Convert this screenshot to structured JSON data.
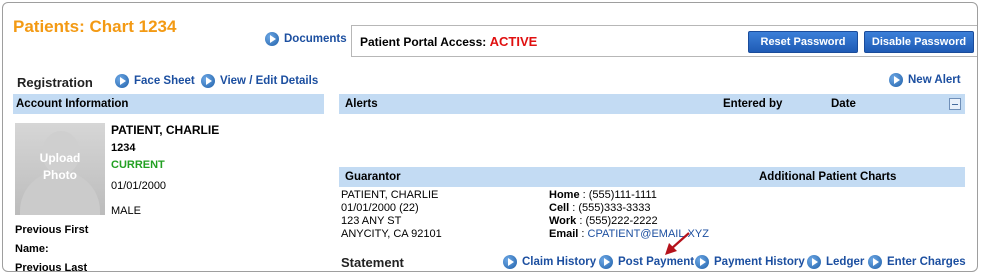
{
  "header": {
    "title": "Patients: Chart 1234",
    "documents_label": "Documents",
    "portal_label": "Patient Portal Access:",
    "portal_status": "ACTIVE",
    "reset_password_label": "Reset Password",
    "disable_password_label": "Disable Password"
  },
  "registration": {
    "title": "Registration",
    "face_sheet_label": "Face Sheet",
    "view_edit_label": "View / Edit Details"
  },
  "account": {
    "bar_title": "Account Information",
    "photo_line1": "Upload",
    "photo_line2": "Photo",
    "name": "PATIENT, CHARLIE",
    "chart_number": "1234",
    "status": "CURRENT",
    "dob": "01/01/2000",
    "sex": "MALE",
    "prev_first_label": "Previous First",
    "prev_first_label2": "Name:",
    "prev_last_label": "Previous Last"
  },
  "alerts": {
    "new_alert_label": "New Alert",
    "col_alerts": "Alerts",
    "col_entered_by": "Entered by",
    "col_date": "Date"
  },
  "guarantor": {
    "bar_title": "Guarantor",
    "additional_charts": "Additional Patient Charts",
    "name": "PATIENT, CHARLIE",
    "dob_age": "01/01/2000 (22)",
    "address1": "123 ANY ST",
    "address2": "ANYCITY, CA 92101",
    "home_label": "Home",
    "home_value": ": (555)111-1111",
    "cell_label": "Cell",
    "cell_value": ": (555)333-3333",
    "work_label": "Work",
    "work_value": ": (555)222-2222",
    "email_label": "Email",
    "email_sep": ":",
    "email_value": "CPATIENT@EMAIL.XYZ"
  },
  "statement": {
    "title": "Statement",
    "links": [
      "Claim History",
      "Post Payment",
      "Payment History",
      "Ledger",
      "Enter Charges"
    ]
  },
  "colors": {
    "title_orange": "#f39a14",
    "link_blue": "#1c4fa0",
    "header_bar": "#c3dbf3",
    "status_active_red": "#e01010",
    "status_current_green": "#22a022",
    "annotation_arrow": "#b5121b"
  }
}
